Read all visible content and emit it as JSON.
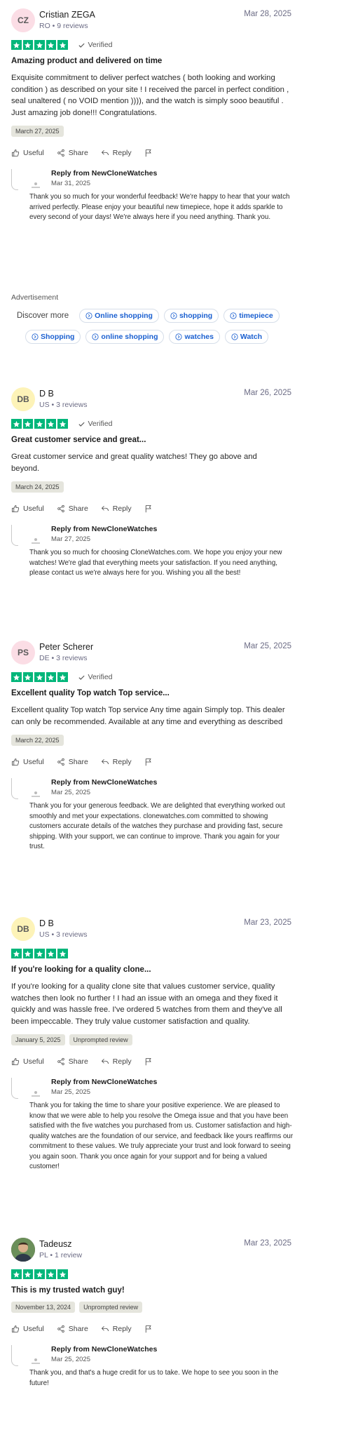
{
  "labels": {
    "verified": "Verified",
    "useful": "Useful",
    "share": "Share",
    "reply": "Reply",
    "reply_from": "Reply from NewCloneWatches"
  },
  "reviews": [
    {
      "initials": "CZ",
      "name": "Cristian ZEGA",
      "meta": "RO • 9 reviews",
      "date": "Mar 28, 2025",
      "verified": true,
      "title": "Amazing product and delivered on time",
      "body": "Exquisite commitment to deliver perfect watches ( both looking and working condition ) as described on your site ! I received the parcel in perfect condition , seal unaltered ( no VOID mention )))), and the watch is simply sooo beautiful . Just amazing job done!!! Congratulations.",
      "chips": [
        "March 27, 2025"
      ],
      "reply_date": "Mar 31, 2025",
      "reply_text": "Thank you so much for your wonderful feedback! We're happy to hear that your watch arrived perfectly. Please enjoy your beautiful new timepiece, hope it adds sparkle to every second of your days! We're always here if you need anything. Thank you."
    },
    {
      "initials": "DB",
      "name": "D B",
      "meta": "US • 3 reviews",
      "date": "Mar 26, 2025",
      "verified": true,
      "title": "Great customer service and great...",
      "body": "Great customer service and great quality watches! They go above and beyond.",
      "chips": [
        "March 24, 2025"
      ],
      "reply_date": "Mar 27, 2025",
      "reply_text": "Thank you so much for choosing CloneWatches.com. We hope you enjoy your new watches! We're glad that everything meets your satisfaction. If you need anything, please contact us we're always here for you. Wishing you all the best!"
    },
    {
      "initials": "PS",
      "name": "Peter Scherer",
      "meta": "DE • 3 reviews",
      "date": "Mar 25, 2025",
      "verified": true,
      "title": "Excellent quality Top watch Top service...",
      "body": "Excellent quality Top watch Top service Any time again Simply top. This dealer can only be recommended. Available at any time and everything as described",
      "chips": [
        "March 22, 2025"
      ],
      "reply_date": "Mar 25, 2025",
      "reply_text": "Thank you for your generous feedback. We are delighted that everything worked out smoothly and met your expectations. clonewatches.com committed to showing customers accurate details of the watches they purchase and providing fast, secure shipping. With your support, we can continue to improve. Thank you again for your trust."
    },
    {
      "initials": "DB",
      "name": "D B",
      "meta": "US • 3 reviews",
      "date": "Mar 23, 2025",
      "verified": false,
      "title": "If you're looking for a quality clone...",
      "body": "If you're looking for a quality clone site that values customer service, quality watches then look no further ! I had an issue with an omega and they fixed it quickly and was hassle free. I've ordered 5 watches from them and they've all been impeccable. They truly value customer satisfaction and quality.",
      "chips": [
        "January 5, 2025",
        "Unprompted review"
      ],
      "reply_date": "Mar 25, 2025",
      "reply_text": "Thank you for taking the time to share your positive experience. We are pleased to know that we were able to help you resolve the Omega issue and that you have been satisfied with the five watches you purchased from us. Customer satisfaction and high-quality watches are the foundation of our service, and feedback like yours reaffirms our commitment to these values. We truly appreciate your trust and look forward to seeing you again soon. Thank you once again for your support and for being a valued customer!"
    },
    {
      "initials": "",
      "name": "Tadeusz",
      "meta": "PL • 1 review",
      "date": "Mar 23, 2025",
      "verified": false,
      "title": "This is my trusted watch guy!",
      "body": "",
      "chips": [
        "November 13, 2024",
        "Unprompted review"
      ],
      "reply_date": "Mar 25, 2025",
      "reply_text": "Thank you, and that's a huge credit for us to take. We hope to see you soon in the future!"
    }
  ],
  "advertisement": {
    "label": "Advertisement",
    "discover": "Discover more",
    "row1": [
      "Online shopping",
      "shopping",
      "timepiece"
    ],
    "row2": [
      "Shopping",
      "online shopping",
      "watches",
      "Watch"
    ]
  },
  "colors": {
    "star_green": "#00b67a",
    "pill_blue": "#1a5fd0",
    "avatar_pink": "#fbdde5",
    "avatar_yellow": "#fdf3b8"
  }
}
